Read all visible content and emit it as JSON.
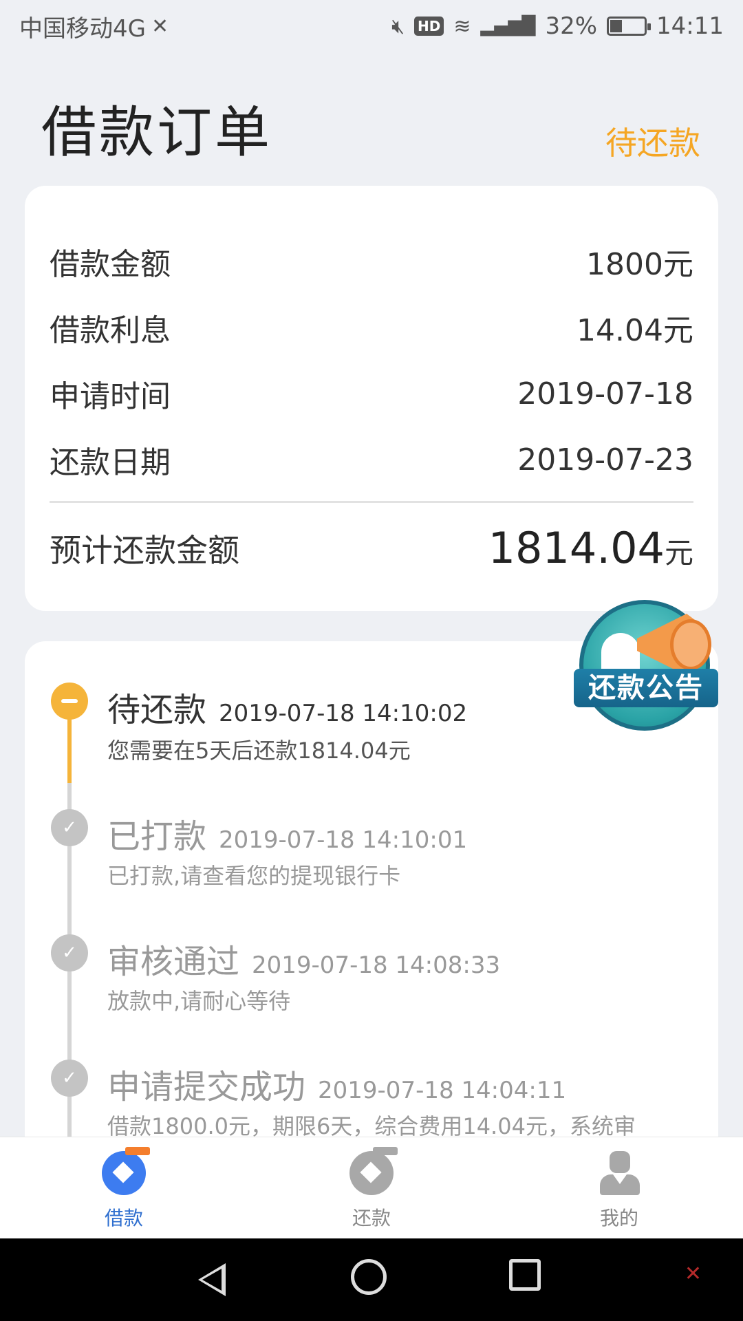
{
  "status_bar": {
    "carrier": "中国移动4G",
    "network": "4G",
    "battery": "32%",
    "time": "14:11"
  },
  "header": {
    "title": "借款订单",
    "status": "待还款"
  },
  "summary": {
    "rows": [
      {
        "label": "借款金额",
        "value": "1800元"
      },
      {
        "label": "借款利息",
        "value": "14.04元"
      },
      {
        "label": "申请时间",
        "value": "2019-07-18"
      },
      {
        "label": "还款日期",
        "value": "2019-07-23"
      }
    ],
    "total_label": "预计还款金额",
    "total_value": "1814.04",
    "total_unit": "元"
  },
  "announcement": {
    "label": "还款公告"
  },
  "timeline": [
    {
      "title": "待还款",
      "time": "2019-07-18 14:10:02",
      "desc": "您需要在5天后还款1814.04元",
      "state": "current"
    },
    {
      "title": "已打款",
      "time": "2019-07-18 14:10:01",
      "desc": "已打款,请查看您的提现银行卡",
      "state": "done"
    },
    {
      "title": "审核通过",
      "time": "2019-07-18 14:08:33",
      "desc": "放款中,请耐心等待",
      "state": "done"
    },
    {
      "title": "申请提交成功",
      "time": "2019-07-18 14:04:11",
      "desc": "借款1800.0元，期限6天，综合费用14.04元，系统审",
      "state": "done"
    }
  ],
  "tabs": [
    {
      "label": "借款",
      "icon": "borrow-icon",
      "active": true
    },
    {
      "label": "还款",
      "icon": "repay-icon",
      "active": false
    },
    {
      "label": "我的",
      "icon": "profile-icon",
      "active": false
    }
  ],
  "colors": {
    "accent": "#f5a623",
    "active_tab": "#2f6fcf",
    "background": "#eef0f4"
  }
}
